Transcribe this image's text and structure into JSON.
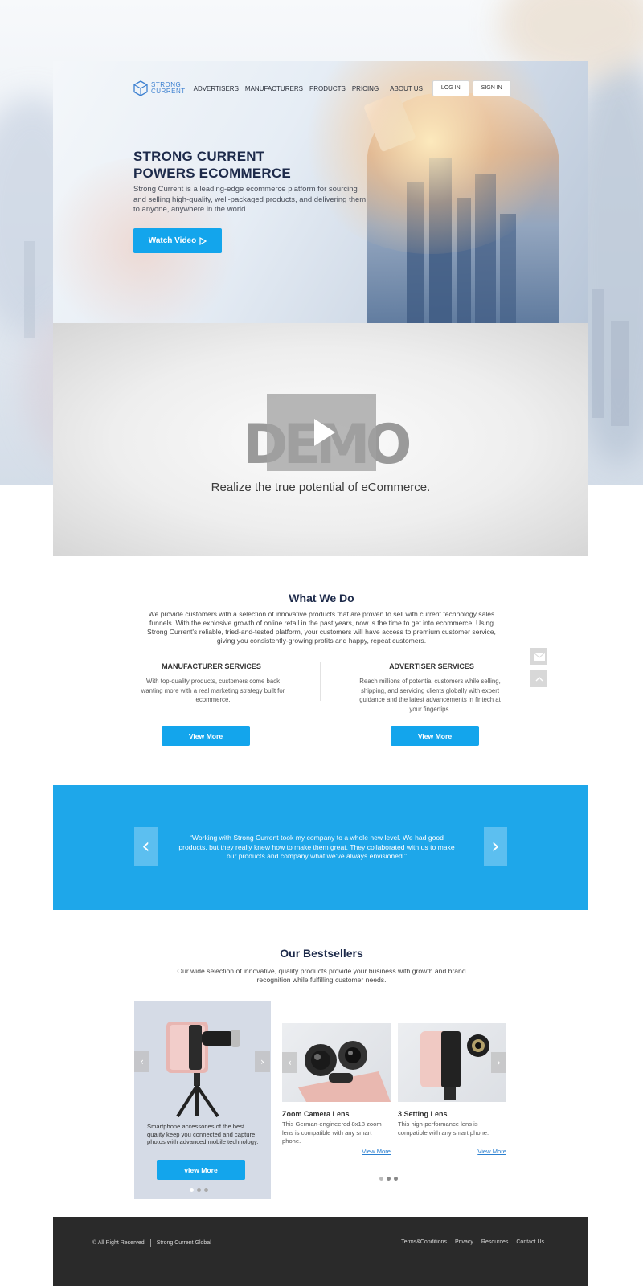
{
  "nav": {
    "logo_line1": "STRONG",
    "logo_line2": "CURRENT",
    "links": [
      "ADVERTISERS",
      "MANUFACTURERS",
      "PRODUCTS",
      "PRICING",
      "ABOUT US"
    ],
    "login": "LOG IN",
    "signin": "SIGN IN"
  },
  "hero": {
    "title_line1": "STRONG CURRENT",
    "title_line2": "POWERS ECOMMERCE",
    "subtitle": "Strong Current is a leading-edge ecommerce platform for sourcing and selling high-quality, well-packaged products, and delivering them to anyone, anywhere in the world.",
    "watch_label": "Watch Video",
    "watch_icon": "play-outline-icon"
  },
  "video": {
    "logo_text": "DEMO",
    "tagline": "Realize the true potential of eCommerce.",
    "play_icon": "play-icon"
  },
  "what_we_do": {
    "title": "What We Do",
    "description": "We provide customers with a selection of innovative products that are proven to sell with current technology sales funnels. With the explosive growth of online retail in the past years, now is the time to get into ecommerce. Using Strong Current's reliable, tried-and-tested platform, your customers will have access to premium customer service, giving you consistently-growing profits and happy, repeat customers.",
    "manufacturer": {
      "title": "MANUFACTURER SERVICES",
      "description": "With top-quality products, customers come back wanting more with a real marketing strategy built for ecommerce.",
      "button": "View More"
    },
    "advertiser": {
      "title": "ADVERTISER SERVICES",
      "description": "Reach millions of potential customers while selling, shipping, and servicing clients globally with expert guidance and the latest advancements in fintech at your fingertips.",
      "button": "View More"
    }
  },
  "side_icons": [
    "mail-icon",
    "arrow-up-icon"
  ],
  "testimonial": {
    "quote": "“Working with Strong Current took my company to a whole new level. We had good products, but they really knew how to make them great. They collaborated with us to make our products and company what we’ve always envisioned.”",
    "prev_icon": "chevron-left-icon",
    "next_icon": "chevron-right-icon"
  },
  "bestsellers": {
    "title": "Our Bestsellers",
    "description": "Our wide selection of innovative, quality products provide your business with growth and brand recognition while fulfilling customer needs.",
    "featured": {
      "description": "Smartphone accessories of the best quality keep you connected and capture photos with advanced mobile technology.",
      "button": "view More"
    },
    "products": [
      {
        "name": "Zoom Camera Lens",
        "description": "This German-engineered 8x18 zoom lens is compatible with any smart phone.",
        "link": "View More"
      },
      {
        "name": "3 Setting Lens",
        "description": "This high-performance lens is compatible with any smart phone.",
        "link": "View More"
      }
    ]
  },
  "footer": {
    "copyright": "© All Right Reserved",
    "brand": "Strong Current  Global",
    "links": [
      "Terms&Conditions",
      "Privacy",
      "Resources",
      "Contact Us"
    ]
  },
  "colors": {
    "accent": "#13a5ec",
    "testimonial_bg": "#1ea7ea",
    "heading": "#1d2a4a",
    "footer_bg": "#2a2a2a"
  }
}
